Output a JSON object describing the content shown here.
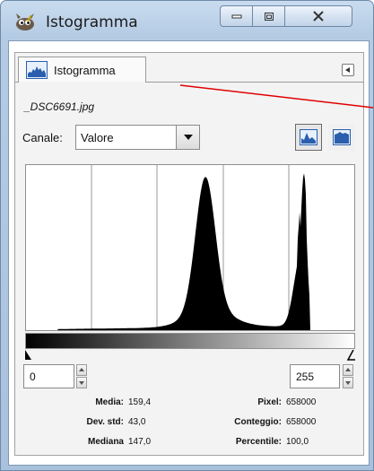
{
  "window": {
    "title": "Istogramma"
  },
  "tab": {
    "label": "Istogramma"
  },
  "file": {
    "name": "_DSC6691.jpg"
  },
  "channel": {
    "label": "Canale:",
    "value": "Valore"
  },
  "range": {
    "min": "0",
    "max": "255"
  },
  "stats": {
    "mean_label": "Media:",
    "mean": "159,4",
    "std_label": "Dev. std:",
    "std": "43,0",
    "median_label": "Mediana",
    "median": "147,0",
    "pixels_label": "Pixel:",
    "pixels": "658000",
    "count_label": "Conteggio:",
    "count": "658000",
    "percentile_label": "Percentile:",
    "percentile": "100,0"
  },
  "icons": {
    "app": "gimp-wilber-icon",
    "tab": "histogram-icon",
    "linear": "linear-histogram-icon",
    "log": "logarithmic-histogram-icon"
  },
  "colors": {
    "annotation_line": "#e00000",
    "histogram_fill": "#000000",
    "grid": "#9a9a9a"
  }
}
